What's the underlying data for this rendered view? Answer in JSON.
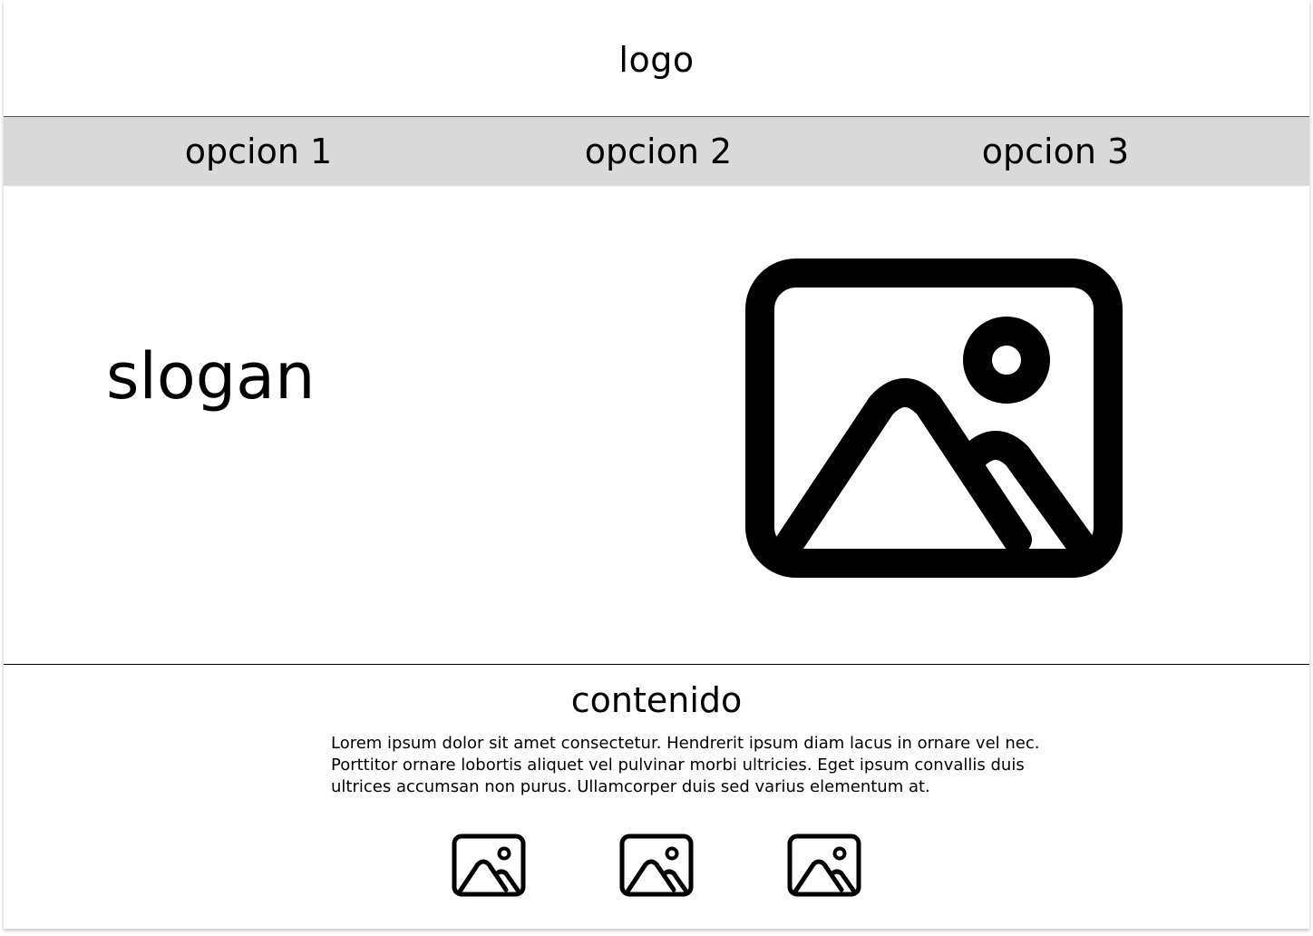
{
  "header": {
    "logo_text": "logo"
  },
  "nav": {
    "items": [
      {
        "label": "opcion 1"
      },
      {
        "label": "opcion 2"
      },
      {
        "label": "opcion 3"
      }
    ]
  },
  "hero": {
    "slogan": "slogan",
    "image_icon": "image-placeholder-icon"
  },
  "content": {
    "title": "contenido",
    "body": "Lorem ipsum dolor sit amet consectetur. Hendrerit ipsum diam lacus in ornare vel nec. Porttitor ornare lobortis aliquet vel pulvinar morbi ultricies. Eget ipsum convallis duis ultrices accumsan non purus. Ullamcorper duis sed varius elementum at.",
    "thumbnails": [
      {
        "icon": "image-placeholder-icon"
      },
      {
        "icon": "image-placeholder-icon"
      },
      {
        "icon": "image-placeholder-icon"
      }
    ]
  },
  "colors": {
    "nav_background": "#d9d9d9",
    "text": "#000000",
    "background": "#ffffff"
  }
}
